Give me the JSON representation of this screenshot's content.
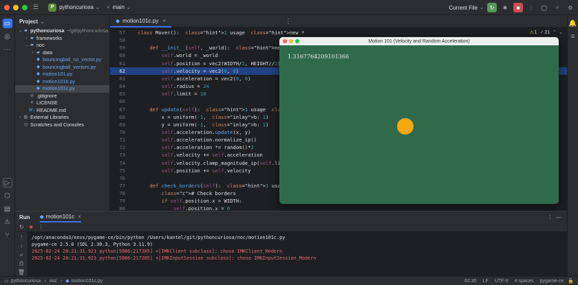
{
  "titlebar": {
    "project_badge": "P",
    "project_name": "pythoncuriosa",
    "branch": "main",
    "run_config": "Current File"
  },
  "project_panel": {
    "title": "Project",
    "items": [
      {
        "label": "pythoncuriosa",
        "suffix": "~/git/pythoncuriosa",
        "depth": 0,
        "arrow": "down",
        "icon": "folder"
      },
      {
        "label": "frameworks",
        "depth": 1,
        "arrow": "right",
        "icon": "folder"
      },
      {
        "label": "noc",
        "depth": 1,
        "arrow": "down",
        "icon": "folder"
      },
      {
        "label": "data",
        "depth": 2,
        "arrow": "right",
        "icon": "folder"
      },
      {
        "label": "bouncingball_no_vector.py",
        "depth": 2,
        "icon": "python",
        "color": "#6aa9f7"
      },
      {
        "label": "bouncingball_vectors.py",
        "depth": 2,
        "icon": "python",
        "color": "#6aa9f7"
      },
      {
        "label": "motion101.py",
        "depth": 2,
        "icon": "python",
        "color": "#6aa9f7"
      },
      {
        "label": "motion101b.py",
        "depth": 2,
        "icon": "python",
        "color": "#6aa9f7"
      },
      {
        "label": "motion101c.py",
        "depth": 2,
        "icon": "python",
        "color": "#6aa9f7",
        "selected": true
      },
      {
        "label": ".gitignore",
        "depth": 1,
        "icon": "gitignore"
      },
      {
        "label": "LICENSE",
        "depth": 1,
        "icon": "file"
      },
      {
        "label": "README.md",
        "depth": 1,
        "icon": "markdown"
      },
      {
        "label": "External Libraries",
        "depth": 0,
        "arrow": "right",
        "icon": "library"
      },
      {
        "label": "Scratches and Consoles",
        "depth": 0,
        "icon": "scratch"
      }
    ]
  },
  "editor": {
    "tab": "motion101c.py",
    "inspections": {
      "warnings": "1",
      "weak_warnings": "21"
    },
    "lines": [
      {
        "n": "57",
        "text": "class Mover():  1 usage  new *"
      },
      {
        "n": "58",
        "text": ""
      },
      {
        "n": "59",
        "text": "    def __init__(self, _world):  new *"
      },
      {
        "n": "60",
        "text": "        self.world = _world"
      },
      {
        "n": "61",
        "text": "        self.position = vec2(WIDTH/2, HEIGHT//2)"
      },
      {
        "n": "62",
        "text": "        self.velocity = vec2(0, 0)",
        "highlight": true
      },
      {
        "n": "63",
        "text": "        self.acceleration = vec2(0, 0)"
      },
      {
        "n": "64",
        "text": "        self.radius = 24"
      },
      {
        "n": "65",
        "text": "        self.limit = 10"
      },
      {
        "n": "66",
        "text": ""
      },
      {
        "n": "67",
        "text": "    def update(self):  1 usage  new *"
      },
      {
        "n": "68",
        "text": "        x = uniform(-1,  b: 1)"
      },
      {
        "n": "69",
        "text": "        y = uniform(-1,  b: 1)"
      },
      {
        "n": "70",
        "text": "        self.acceleration.update(x, y)"
      },
      {
        "n": "71",
        "text": "        self.acceleration.normalize_ip()"
      },
      {
        "n": "72",
        "text": "        self.acceleration *= random()*2"
      },
      {
        "n": "73",
        "text": "        self.velocity += self.acceleration"
      },
      {
        "n": "74",
        "text": "        self.velocity.clamp_magnitude_ip(self.limit)"
      },
      {
        "n": "75",
        "text": "        self.position += self.velocity"
      },
      {
        "n": "76",
        "text": ""
      },
      {
        "n": "77",
        "text": "    def check_borders(self):  1 usage  new *"
      },
      {
        "n": "78",
        "text": "        # Check borders"
      },
      {
        "n": "79",
        "text": "        if self.position.x > WIDTH:"
      },
      {
        "n": "80",
        "text": "            self.position.x = 0"
      }
    ]
  },
  "pygame_window": {
    "title": "Motion 101 (Velocity and Random Acceleration)",
    "value_text": "1.3167764209101366",
    "background": "#2f6b4b",
    "ball_color": "#f5a70f"
  },
  "run_panel": {
    "title": "Run",
    "tab": "motion101c",
    "console": [
      {
        "text": "/opt/anaconda3/envs/pygame-ce/bin/python /Users/kantel/git/pythoncuriosa/noc/motion101c.py",
        "type": "normal"
      },
      {
        "text": "pygame-ce 2.5.0 (SDL 2.30.3, Python 3.11.9)",
        "type": "normal"
      },
      {
        "text": "2025-02-24 20:21:31.923 python[5086:217285] +[IMKClient subclass]: chose IMKClient_Modern",
        "type": "error"
      },
      {
        "text": "2025-02-24 20:21:31.923 python[5086:217285] +[IMKInputSession subclass]: chose IMKInputSession_Modern",
        "type": "error"
      }
    ]
  },
  "statusbar": {
    "breadcrumbs": [
      "pythoncuriosa",
      "noc",
      "motion101c.py"
    ],
    "position": "62:35",
    "line_ending": "LF",
    "encoding": "UTF-8",
    "indent": "4 spaces",
    "interpreter": "pygame-ce"
  }
}
